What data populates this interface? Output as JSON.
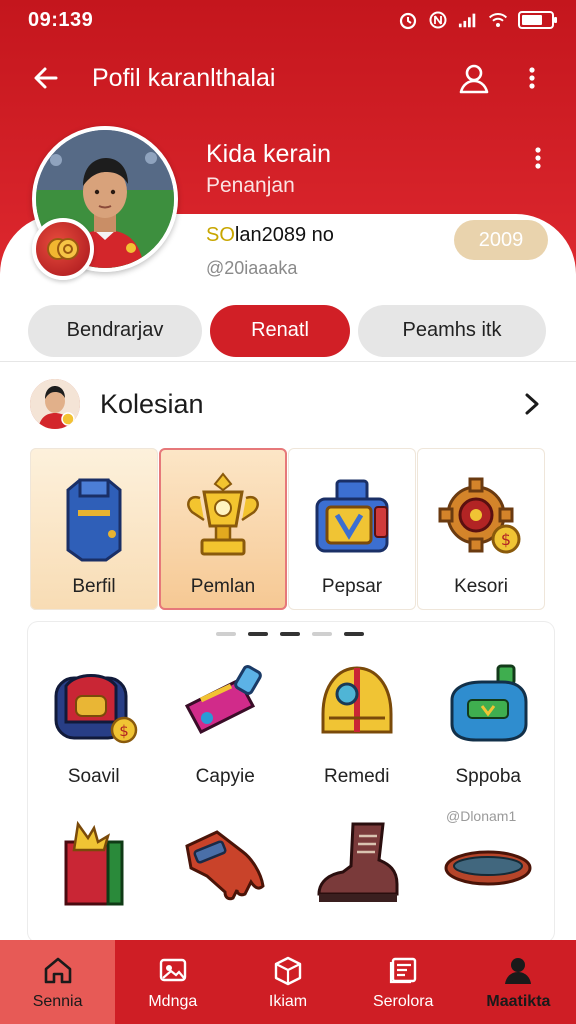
{
  "status_bar": {
    "time": "09:139"
  },
  "appbar": {
    "title": "Pofil karanlthalai"
  },
  "profile": {
    "name": "Kida kerain",
    "role": "Penanjan",
    "handle_highlight": "SO",
    "handle_rest": "lan2089 no",
    "sub": "@20iaaaka",
    "points": "2009"
  },
  "tabs": [
    {
      "label": "Bendrarjav",
      "active": false
    },
    {
      "label": "Renatl",
      "active": true
    },
    {
      "label": "Peamhs itk",
      "active": false
    }
  ],
  "section": {
    "title": "Kolesian",
    "categories": [
      {
        "label": "Berfil",
        "icon": "blue-armor-icon"
      },
      {
        "label": "Pemlan",
        "icon": "gold-trophy-icon"
      },
      {
        "label": "Pepsar",
        "icon": "treasure-box-icon"
      },
      {
        "label": "Kesori",
        "icon": "gear-badge-icon"
      }
    ],
    "items": [
      {
        "label": "Soavil",
        "icon": "backpack-icon"
      },
      {
        "label": "Capyie",
        "icon": "pink-case-icon"
      },
      {
        "label": "Remedi",
        "icon": "gold-helmet-icon"
      },
      {
        "label": "Sppoba",
        "icon": "blue-bottle-icon"
      },
      {
        "label": "",
        "icon": "gift-box-icon"
      },
      {
        "label": "",
        "icon": "glove-icon"
      },
      {
        "label": "",
        "icon": "boot-icon"
      },
      {
        "label": "",
        "icon": "belt-icon"
      }
    ],
    "item_note": "@Dlonam1"
  },
  "bottom_nav": [
    {
      "label": "Sennia",
      "icon": "home-icon",
      "active": true
    },
    {
      "label": "Mdnga",
      "icon": "photo-icon",
      "active": false
    },
    {
      "label": "Ikiam",
      "icon": "box-icon",
      "active": false
    },
    {
      "label": "Serolora",
      "icon": "clipboard-icon",
      "active": false
    },
    {
      "label": "Maatikta",
      "icon": "person-icon",
      "active": false
    }
  ],
  "colors": {
    "brand_red": "#d11f26",
    "gold_pill": "#e9d3ad"
  }
}
